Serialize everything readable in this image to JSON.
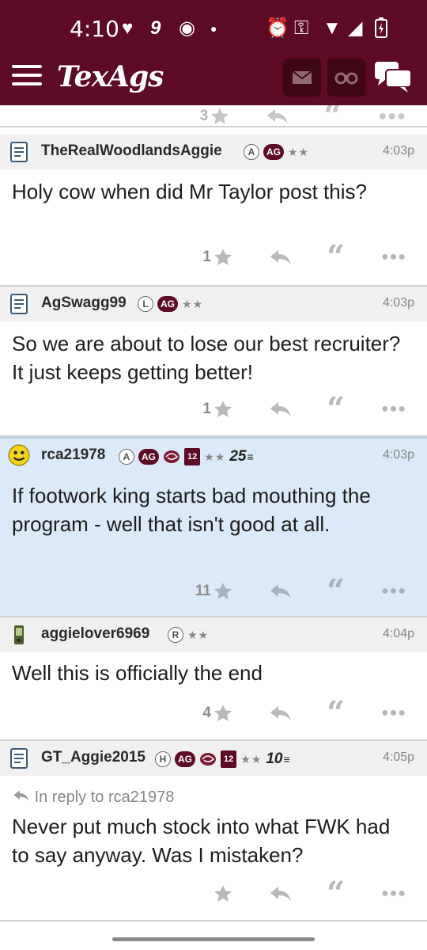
{
  "status_bar": {
    "time": "4:10"
  },
  "app": {
    "logo": "TexAgs",
    "brand_color": "#5d0a25",
    "highlight_color": "#dbe9f8"
  },
  "partial_post": {
    "likes": "3"
  },
  "posts": [
    {
      "username": "TheRealWoodlandsAggie",
      "avatar": "post-icon",
      "badges": [
        "A",
        "AG"
      ],
      "stars": "★★",
      "time": "4:03p",
      "body": "Holy cow when did Mr Taylor post this?",
      "likes": "1"
    },
    {
      "username": "AgSwagg99",
      "avatar": "post-icon",
      "badges": [
        "L",
        "AG"
      ],
      "stars": "★★",
      "time": "4:03p",
      "body": "So we are about to lose our best recruiter? It just keeps getting better!",
      "likes": "1"
    },
    {
      "username": "rca21978",
      "avatar": "smiley-icon",
      "badges": [
        "A",
        "AG",
        "12"
      ],
      "stars": "★★",
      "points": "25",
      "time": "4:03p",
      "body": "If footwork king starts bad mouthing the program - well that isn't good at all.",
      "likes": "11",
      "highlighted": true
    },
    {
      "username": "aggielover6969",
      "avatar": "phone-icon",
      "badges": [
        "R"
      ],
      "stars": "★★",
      "time": "4:04p",
      "body": "Well this is officially the end",
      "likes": "4"
    },
    {
      "username": "GT_Aggie2015",
      "avatar": "post-icon",
      "badges": [
        "H",
        "AG",
        "12"
      ],
      "stars": "★★",
      "points": "10",
      "time": "4:05p",
      "reply_to": "In reply to rca21978",
      "body": "Never put much stock into what FWK had to say anyway. Was I mistaken?",
      "likes": ""
    }
  ]
}
